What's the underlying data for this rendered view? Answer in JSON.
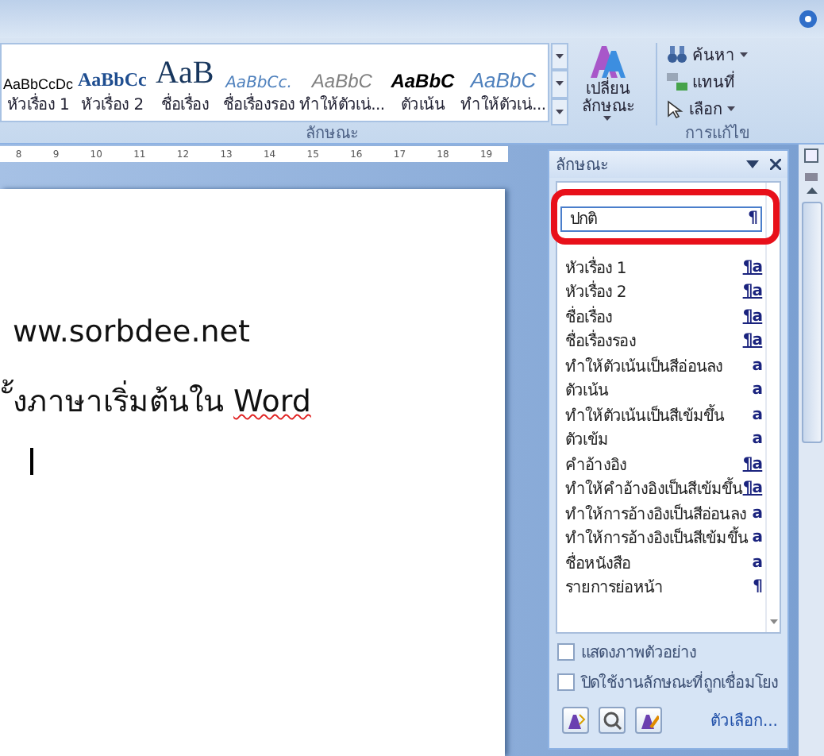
{
  "ribbon": {
    "gallery": [
      {
        "preview": "AaBbCcDc",
        "label": "หัวเรื่อง 1",
        "kind": "plain"
      },
      {
        "preview": "AaBbCc",
        "label": "หัวเรื่อง 2",
        "kind": "heading"
      },
      {
        "preview": "AaB",
        "label": "ชื่อเรื่อง",
        "kind": "title"
      },
      {
        "preview": "AaBbCc.",
        "label": "ชื่อเรื่องรอง",
        "kind": "subtitle"
      },
      {
        "preview": "AaBbC",
        "label": "ทำให้ตัวเน่...",
        "kind": "subtle"
      },
      {
        "preview": "AaBbC",
        "label": "ตัวเน้น",
        "kind": "emphasis"
      },
      {
        "preview": "AaBbC",
        "label": "ทำให้ตัวเน่...",
        "kind": "intense"
      }
    ],
    "change_styles": {
      "label": "เปลี่ยน ลักษณะ"
    },
    "styles_group_label": "ลักษณะ",
    "editing": [
      {
        "label": "ค้นหา",
        "kind": "find",
        "dropdown": true
      },
      {
        "label": "แทนที่",
        "kind": "replace",
        "dropdown": false
      },
      {
        "label": "เลือก",
        "kind": "select",
        "dropdown": true
      }
    ],
    "editing_group_label": "การแก้ไข"
  },
  "ruler": {
    "labels": [
      "8",
      "9",
      "10",
      "11",
      "12",
      "13",
      "14",
      "15",
      "16",
      "17",
      "18",
      "19"
    ]
  },
  "document": {
    "lines": [
      {
        "runs": [
          {
            "text": "ww.sorbdee.net",
            "misspelled": false
          }
        ]
      },
      {
        "runs": [
          {
            "text": "ั้งภาษาเริ่มต้นใน ",
            "misspelled": false
          },
          {
            "text": "Word",
            "misspelled": true
          }
        ]
      }
    ]
  },
  "styles_pane": {
    "title": "ลักษณะ",
    "items": [
      {
        "name": "ปกติ",
        "kind": "paragraph",
        "type_mark": "¶",
        "selected": true
      },
      {
        "name": "หัวเรื่อง 1",
        "kind": "linked",
        "type_mark": "¶a",
        "selected": false
      },
      {
        "name": "หัวเรื่อง 2",
        "kind": "linked",
        "type_mark": "¶a",
        "selected": false
      },
      {
        "name": "ชื่อเรื่อง",
        "kind": "linked",
        "type_mark": "¶a",
        "selected": false
      },
      {
        "name": "ชื่อเรื่องรอง",
        "kind": "linked",
        "type_mark": "¶a",
        "selected": false
      },
      {
        "name": "ทำให้ตัวเน้นเป็นสีอ่อนลง",
        "kind": "character",
        "type_mark": "a",
        "selected": false
      },
      {
        "name": "ตัวเน้น",
        "kind": "character",
        "type_mark": "a",
        "selected": false
      },
      {
        "name": "ทำให้ตัวเน้นเป็นสีเข้มขึ้น",
        "kind": "character",
        "type_mark": "a",
        "selected": false
      },
      {
        "name": "ตัวเข้ม",
        "kind": "character",
        "type_mark": "a",
        "selected": false
      },
      {
        "name": "คำอ้างอิง",
        "kind": "linked",
        "type_mark": "¶a",
        "selected": false
      },
      {
        "name": "ทำให้คำอ้างอิงเป็นสีเข้มขึ้น",
        "kind": "linked",
        "type_mark": "¶a",
        "selected": false
      },
      {
        "name": "ทำให้การอ้างอิงเป็นสีอ่อนลง",
        "kind": "character",
        "type_mark": "a",
        "selected": false
      },
      {
        "name": "ทำให้การอ้างอิงเป็นสีเข้มขึ้น",
        "kind": "character",
        "type_mark": "a",
        "selected": false
      },
      {
        "name": "ชื่อหนังสือ",
        "kind": "character",
        "type_mark": "a",
        "selected": false
      },
      {
        "name": "รายการย่อหน้า",
        "kind": "paragraph",
        "type_mark": "¶",
        "selected": false
      }
    ],
    "options": [
      {
        "label": "แสดงภาพตัวอย่าง",
        "checked": false
      },
      {
        "label": "ปิดใช้งานลักษณะที่ถูกเชื่อมโยง",
        "checked": false
      }
    ],
    "options_link": "ตัวเลือก..."
  }
}
